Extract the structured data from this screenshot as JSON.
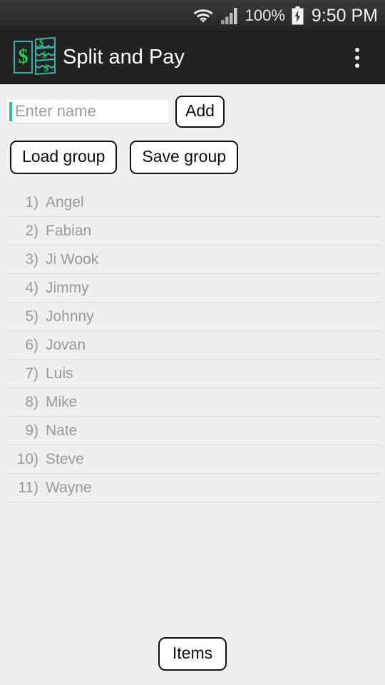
{
  "status_bar": {
    "wifi_icon": "wifi-icon",
    "signal_icon": "cellular-signal-icon",
    "battery_percent": "100%",
    "battery_icon": "battery-charging-icon",
    "time": "9:50 PM",
    "background_color": "#2f2f2f"
  },
  "action_bar": {
    "logo_icon": "split-bill-logo-icon",
    "title": "Split and Pay",
    "overflow_icon": "overflow-menu-icon",
    "background_color": "#222222",
    "title_color": "#ffffff",
    "logo_accent_color": "#22cc55",
    "logo_outline_color": "#3aada8"
  },
  "entry": {
    "input_placeholder": "Enter name",
    "input_value": "",
    "caret_color": "#33b5b5",
    "add_label": "Add"
  },
  "group_actions": {
    "load_label": "Load group",
    "save_label": "Save group"
  },
  "names": [
    {
      "index": "1)",
      "name": "Angel"
    },
    {
      "index": "2)",
      "name": "Fabian"
    },
    {
      "index": "3)",
      "name": "Ji Wook"
    },
    {
      "index": "4)",
      "name": "Jimmy"
    },
    {
      "index": "5)",
      "name": "Johnny"
    },
    {
      "index": "6)",
      "name": "Jovan"
    },
    {
      "index": "7)",
      "name": "Luis"
    },
    {
      "index": "8)",
      "name": "Mike"
    },
    {
      "index": "9)",
      "name": "Nate"
    },
    {
      "index": "10)",
      "name": "Steve"
    },
    {
      "index": "11)",
      "name": "Wayne"
    }
  ],
  "footer": {
    "items_label": "Items"
  },
  "colors": {
    "page_background": "#efefef",
    "list_text": "#9a9a9a",
    "divider": "#dedede",
    "button_border": "#111111"
  }
}
